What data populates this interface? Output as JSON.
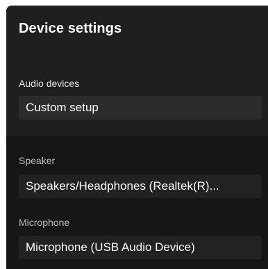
{
  "dialog": {
    "title": "Device settings"
  },
  "audio_devices": {
    "label": "Audio devices",
    "value": "Custom setup"
  },
  "speaker": {
    "label": "Speaker",
    "value": "Speakers/Headphones (Realtek(R)..."
  },
  "microphone": {
    "label": "Microphone",
    "value": "Microphone (USB Audio Device)"
  },
  "colors": {
    "panel_bg": "#1f1f1f",
    "lower_bg": "#161616",
    "text": "#ffffff"
  }
}
